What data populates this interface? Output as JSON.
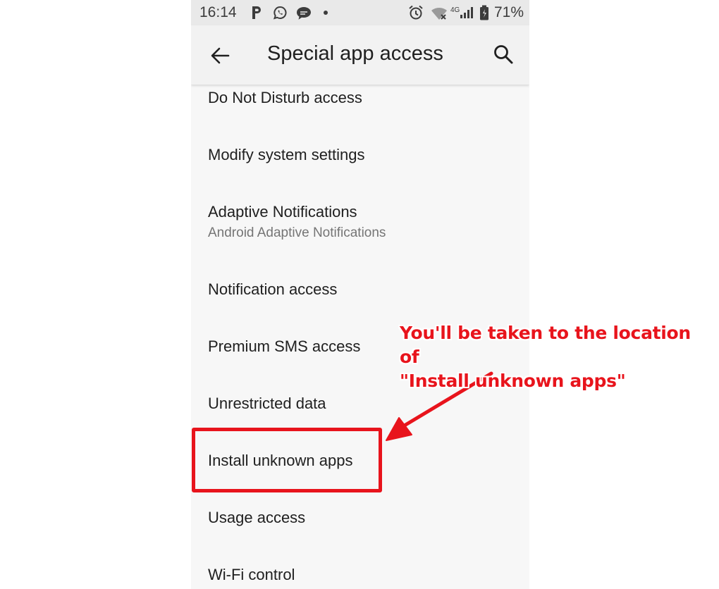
{
  "status_bar": {
    "time": "16:14",
    "network_label": "4G",
    "battery_percent": "71%",
    "icons": [
      "parking-app-icon",
      "whatsapp-icon",
      "chat-bubble-icon",
      "notification-dot-icon",
      "alarm-icon",
      "wifi-off-icon",
      "cell-signal-icon",
      "battery-icon"
    ]
  },
  "app_bar": {
    "title": "Special app access",
    "back_icon": "arrow-left-icon",
    "search_icon": "search-icon"
  },
  "settings_list": [
    {
      "title": "Do Not Disturb access"
    },
    {
      "title": "Modify system settings"
    },
    {
      "title": "Adaptive Notifications",
      "subtitle": "Android Adaptive Notifications"
    },
    {
      "title": "Notification access"
    },
    {
      "title": "Premium SMS access"
    },
    {
      "title": "Unrestricted data"
    },
    {
      "title": "Install unknown apps"
    },
    {
      "title": "Usage access"
    },
    {
      "title": "Wi-Fi control"
    }
  ],
  "annotation": {
    "line1": "You'll be taken to the location of",
    "line2": "\"Install unknown apps\"",
    "color": "#e8141c"
  },
  "colors": {
    "annotation_red": "#e8141c",
    "status_bar_bg": "#e9e9e9",
    "app_bar_bg": "#f2f2f2",
    "list_bg": "#f7f7f7"
  }
}
